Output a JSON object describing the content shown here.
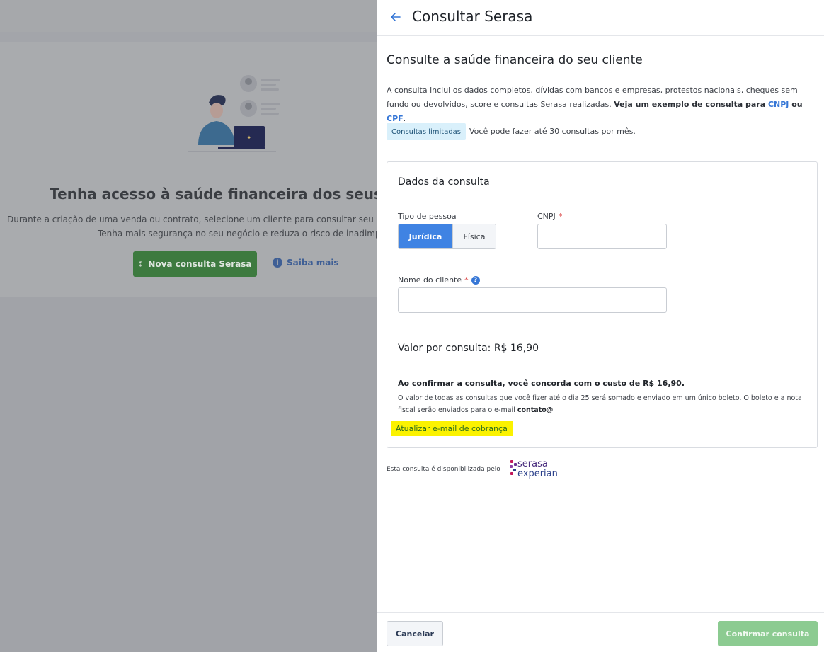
{
  "background": {
    "title": "Tenha acesso à saúde financeira dos seus client",
    "desc_line1": "Durante a criação de uma venda ou contrato, selecione um cliente para consultar seu CPF ou CN",
    "desc_line2": "Tenha mais segurança no seu negócio e reduza o risco de inadimplência.",
    "new_button": "Nova consulta Serasa",
    "learn_more": "Saiba mais"
  },
  "drawer": {
    "title": "Consultar Serasa",
    "section_title": "Consulte a saúde financeira do seu cliente",
    "intro_text": "A consulta inclui os dados completos, dívidas com bancos e empresas, protestos nacionais, cheques sem fundo ou devolvidos, score e consultas Serasa realizadas. ",
    "intro_bold": "Veja um exemplo de consulta para ",
    "link_cnpj": "CNPJ",
    "intro_or": " ou ",
    "link_cpf": "CPF",
    "intro_end": ".",
    "badge": "Consultas limitadas",
    "badge_text": "Você pode fazer até 30 consultas por mês."
  },
  "form": {
    "panel_title": "Dados da consulta",
    "person_type_label": "Tipo de pessoa",
    "option_juridica": "Jurídica",
    "option_fisica": "Física",
    "cnpj_label": "CNPJ",
    "required_mark": "*",
    "client_name_label": "Nome do cliente",
    "help": "?",
    "cnpj_value": "",
    "client_name_value": "",
    "price_label": "Valor por consulta: R$ 16,90",
    "agree_text": "Ao confirmar a consulta, você concorda com o custo de R$ 16,90.",
    "fine_print": "O valor de todas as consultas que você fizer até o dia 25 será somado e enviado em um único boleto. O boleto e a nota fiscal serão enviados para o e-mail ",
    "email": "contato@",
    "update_email": "Atualizar e-mail de cobrança"
  },
  "provider": {
    "text": "Esta consulta é disponibilizada pelo",
    "logo_line1": "serasa",
    "logo_line2": "experian"
  },
  "footer": {
    "cancel": "Cancelar",
    "confirm": "Confirmar consulta"
  },
  "colors": {
    "accent": "#3f83e3",
    "link": "#3576d6",
    "confirm_disabled": "#8ccb91",
    "highlight": "#fbf200"
  }
}
